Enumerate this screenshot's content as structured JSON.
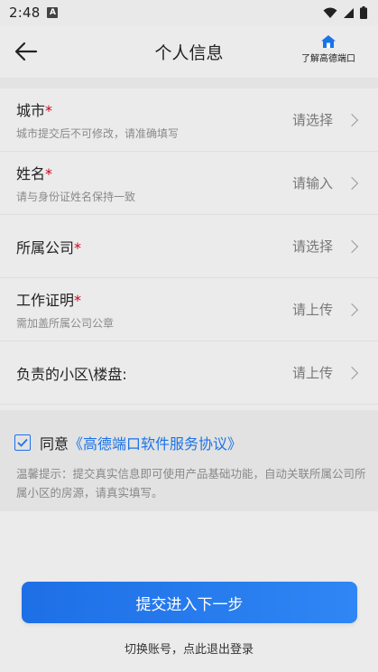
{
  "status_bar": {
    "time": "2:48",
    "badge": "A",
    "icons": [
      "wifi-icon",
      "signal-icon",
      "battery-icon"
    ]
  },
  "header": {
    "title": "个人信息",
    "back_icon": "arrow-left-icon",
    "link_label": "了解高德端口",
    "link_icon": "home-icon"
  },
  "form": {
    "rows": [
      {
        "title": "城市",
        "required": "*",
        "hint": "城市提交后不可修改，请准确填写",
        "value": "请选择"
      },
      {
        "title": "姓名",
        "required": "*",
        "hint": "请与身份证姓名保持一致",
        "value": "请输入"
      },
      {
        "title": "所属公司",
        "required": "*",
        "hint": "",
        "value": "请选择"
      },
      {
        "title": "工作证明",
        "required": "*",
        "hint": "需加盖所属公司公章",
        "value": "请上传"
      },
      {
        "title": "负责的小区\\楼盘:",
        "required": "",
        "hint": "",
        "value": "请上传"
      }
    ]
  },
  "agreement": {
    "checked": true,
    "prefix": "同意",
    "link": "《高德端口软件服务协议》",
    "tip": "温馨提示：提交真实信息即可使用产品基础功能，自动关联所属公司所属小区的房源，请真实填写。"
  },
  "actions": {
    "submit": "提交进入下一步",
    "switch_account": "切换账号，点此退出登录"
  },
  "colors": {
    "accent": "#1a73e8",
    "required": "#d0021b"
  }
}
